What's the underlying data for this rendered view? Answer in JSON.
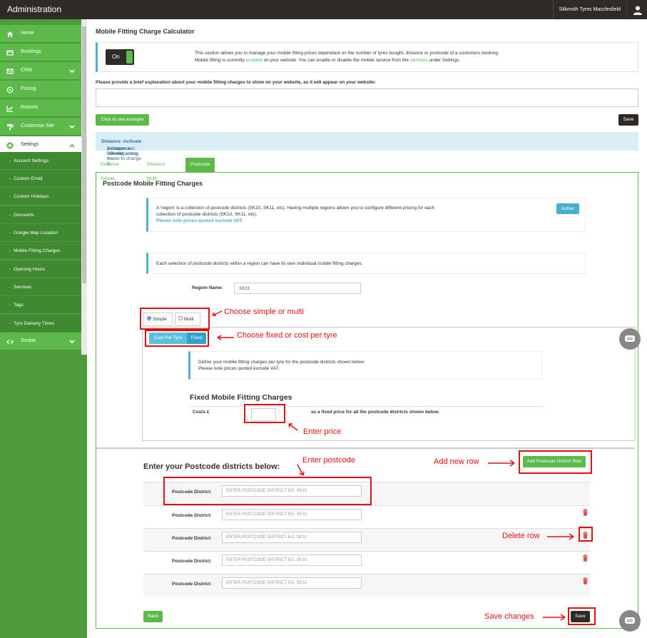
{
  "topbar": {
    "title": "Administration",
    "user": "Silkmoth Tyres Macclesfield",
    "user_icon": "user-icon"
  },
  "sidebar": {
    "items": [
      {
        "label": "Home",
        "icon": "home-icon",
        "has_chevron": false
      },
      {
        "label": "Bookings",
        "icon": "bookings-icon",
        "has_chevron": false
      },
      {
        "label": "CRM",
        "icon": "envelope-icon",
        "has_chevron": true
      },
      {
        "label": "Pricing",
        "icon": "pricing-icon",
        "has_chevron": false
      },
      {
        "label": "Reports",
        "icon": "chart-icon",
        "has_chevron": false
      },
      {
        "label": "Customise Site",
        "icon": "paint-roller-icon",
        "has_chevron": true
      },
      {
        "label": "Settings",
        "icon": "gear-icon",
        "has_chevron": true,
        "active": true
      }
    ],
    "sub_items": [
      "Account Settings",
      "Custom Email",
      "Custom Holidays",
      "Discounts",
      "Google Map Location",
      "Mobile Fitting Charges",
      "Opening Hours",
      "Services",
      "Tags",
      "Tyre Delivery Times"
    ],
    "scripts_item": {
      "label": "Scripts",
      "icon": "code-icon"
    }
  },
  "main": {
    "page_title": "Mobile Fitting Charge Calculator",
    "toggle_label": "On",
    "info_line1": "This section allows you to manage your mobile fitting prices dependant on the number of tyres bought, distance or postcode of a customers booking.",
    "info_line2_pre": "Mobile fitting is currently ",
    "info_line2_enabled": "enabled",
    "info_line2_mid": " on your website. You can enable or disable the mobile service from the ",
    "info_line2_services": "Services",
    "info_line2_post": " under Settings.",
    "explain_label": "Please provide a brief explanation about your mobile fitting charges to show on your website, as it will appear on your website:",
    "example_button": "Click to see example",
    "save_button": "Save",
    "notice_pre": "You are currently using the ",
    "notice_model": "Distance -",
    "notice_mid": " pricing model. Use the ",
    "notice_activate": "Activate",
    "notice_post": " button on a different pricing model to change it.",
    "tabs": [
      "Distance Simple",
      "Distance Multi",
      "Postcode"
    ]
  },
  "panel": {
    "title": "Postcode Mobile Fitting Charges",
    "region_line1": "A 'region' is a collection of postcode districts (SK10, SK11, etc). Having multiple regions allows you to configure different pricing for each",
    "region_line2": "collection of postcode districts (SK10, SK11, etc).",
    "region_note": "Please note prices quoted exclude VAT.",
    "active_badge": "Active",
    "each_text": "Each selection of postcode districts within a region can have its own individual mobile fitting charges.",
    "region_name_label": "Region Name:",
    "region_name_value": "SK11",
    "radio_simple": "Simple",
    "radio_multi": "Multi",
    "seg_cost_per_tyre": "Cost Per Tyre",
    "seg_fixed": "Fixed",
    "define_line1": "Define your mobile fitting charges per tyre for the postcode districts shown below:",
    "define_line2": "Please note prices quoted exclude VAT.",
    "fixed_title": "Fixed Mobile Fitting Charges",
    "costs_label": "Costs £",
    "costs_after": "as a fixed price for all the postcode districts shown below.",
    "enter_title": "Enter your Postcode districts below:",
    "add_row_button": "Add Postcode District Row",
    "postcode_label": "Postcode District:",
    "postcode_placeholder": "ENTER POSTCODE DISTRICT EG. SK10",
    "back_button": "Back",
    "save_button": "Save"
  },
  "annotations": {
    "simple_multi": "Choose simple or multi",
    "fixed_cost": "Choose fixed or cost per tyre",
    "enter_price": "Enter price",
    "enter_postcode": "Enter postcode",
    "add_new_row": "Add new row",
    "delete_row": "Delete row",
    "save_changes": "Save changes"
  },
  "colors": {
    "brand_green": "#5cb94a",
    "info_blue": "#49afcd",
    "annotation_red": "#e01010",
    "topbar_dark": "#2e2a26"
  }
}
